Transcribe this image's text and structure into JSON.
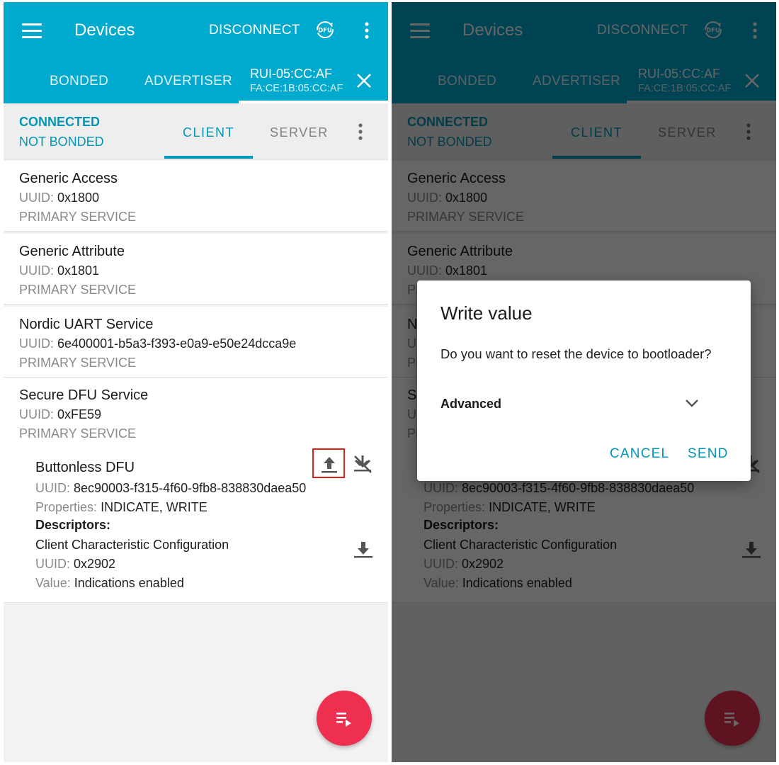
{
  "appbar": {
    "title": "Devices",
    "disconnect_label": "DISCONNECT",
    "dfu_icon_label": "DFU",
    "icons": {
      "menu": "hamburger-menu-icon",
      "dfu": "dfu-icon",
      "more": "more-vert-icon"
    }
  },
  "device_tabs": {
    "bonded": "BONDED",
    "advertiser": "ADVERTISER",
    "active_name": "RUI-05:CC:AF",
    "active_address": "FA:CE:1B:05:CC:AF"
  },
  "connection": {
    "state": "CONNECTED",
    "bond_state": "NOT BONDED",
    "tab_client": "CLIENT",
    "tab_server": "SERVER"
  },
  "services": [
    {
      "name": "Generic Access",
      "uuid_label": "UUID:",
      "uuid": "0x1800",
      "type": "PRIMARY SERVICE"
    },
    {
      "name": "Generic Attribute",
      "uuid_label": "UUID:",
      "uuid": "0x1801",
      "type": "PRIMARY SERVICE"
    },
    {
      "name": "Nordic UART Service",
      "uuid_label": "UUID:",
      "uuid": "6e400001-b5a3-f393-e0a9-e50e24dcca9e",
      "type": "PRIMARY SERVICE"
    },
    {
      "name": "Secure DFU Service",
      "uuid_label": "UUID:",
      "uuid": "0xFE59",
      "type": "PRIMARY SERVICE"
    }
  ],
  "characteristic": {
    "name": "Buttonless DFU",
    "uuid_label": "UUID:",
    "uuid": "8ec90003-f315-4f60-9fb8-838830daea50",
    "properties_label": "Properties:",
    "properties": "INDICATE, WRITE",
    "descriptors_label": "Descriptors:",
    "descriptor_name": "Client Characteristic Configuration",
    "descriptor_uuid_label": "UUID:",
    "descriptor_uuid": "0x2902",
    "value_label": "Value:",
    "value": "Indications enabled"
  },
  "dialog": {
    "title": "Write value",
    "message": "Do you want to reset the device to bootloader?",
    "advanced_label": "Advanced",
    "cancel_label": "CANCEL",
    "send_label": "SEND"
  },
  "colors": {
    "appbar": "#00a9ce",
    "accent": "#0097b8",
    "fab": "#ee2f4f",
    "highlight_box": "#d9221c"
  }
}
